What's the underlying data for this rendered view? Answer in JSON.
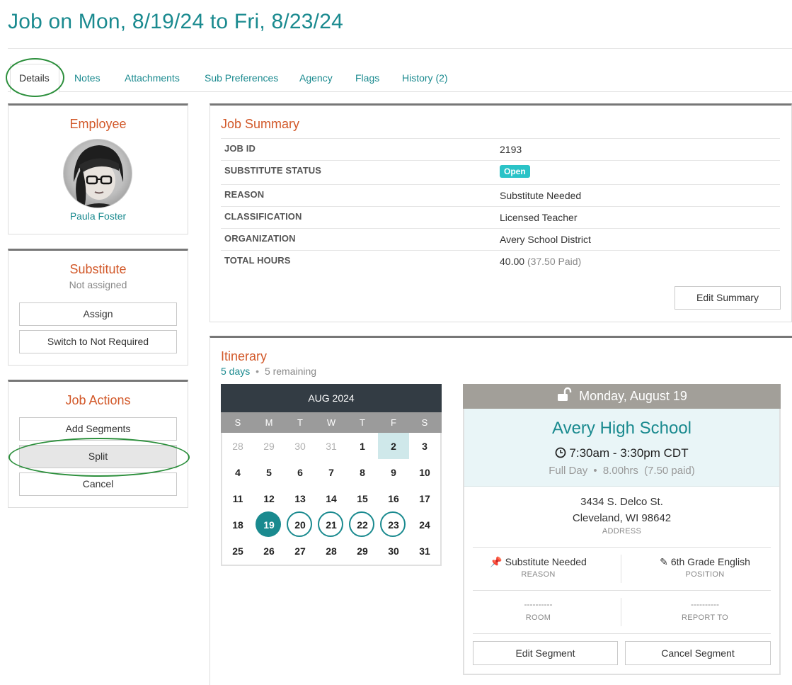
{
  "page": {
    "title": "Job on Mon, 8/19/24 to Fri, 8/23/24"
  },
  "tabs": [
    {
      "label": "Details"
    },
    {
      "label": "Notes"
    },
    {
      "label": "Attachments"
    },
    {
      "label": "Sub Preferences"
    },
    {
      "label": "Agency"
    },
    {
      "label": "Flags"
    },
    {
      "label": "History (2)"
    }
  ],
  "employee": {
    "title": "Employee",
    "name": "Paula Foster"
  },
  "substitute": {
    "title": "Substitute",
    "status": "Not assigned",
    "assign_label": "Assign",
    "not_required_label": "Switch to Not Required"
  },
  "job_actions": {
    "title": "Job Actions",
    "add_segments_label": "Add Segments",
    "split_label": "Split",
    "cancel_label": "Cancel"
  },
  "summary": {
    "title": "Job Summary",
    "rows": [
      {
        "label": "JOB ID",
        "value": "2193"
      },
      {
        "label": "SUBSTITUTE STATUS",
        "value": "Open"
      },
      {
        "label": "REASON",
        "value": "Substitute Needed"
      },
      {
        "label": "CLASSIFICATION",
        "value": "Licensed Teacher"
      },
      {
        "label": "ORGANIZATION",
        "value": "Avery School District"
      },
      {
        "label": "TOTAL HOURS",
        "value": "40.00",
        "extra": "(37.50 Paid)"
      }
    ],
    "edit_label": "Edit Summary"
  },
  "itinerary": {
    "title": "Itinerary",
    "days": "5 days",
    "separator": "•",
    "remaining": "5 remaining"
  },
  "calendar": {
    "month_label": "AUG 2024",
    "dow": [
      "S",
      "M",
      "T",
      "W",
      "T",
      "F",
      "S"
    ],
    "weeks": [
      [
        "28",
        "29",
        "30",
        "31",
        "1",
        "2",
        "3"
      ],
      [
        "4",
        "5",
        "6",
        "7",
        "8",
        "9",
        "10"
      ],
      [
        "11",
        "12",
        "13",
        "14",
        "15",
        "16",
        "17"
      ],
      [
        "18",
        "19",
        "20",
        "21",
        "22",
        "23",
        "24"
      ],
      [
        "25",
        "26",
        "27",
        "28",
        "29",
        "30",
        "31"
      ]
    ]
  },
  "segment": {
    "date": "Monday, August 19",
    "school": "Avery High School",
    "time": "7:30am - 3:30pm CDT",
    "day_type": "Full Day",
    "separator": "•",
    "hours": "8.00hrs",
    "paid": "(7.50 paid)",
    "address_line1": "3434 S. Delco St.",
    "address_line2": "Cleveland, WI 98642",
    "address_label": "ADDRESS",
    "reason_value": "Substitute Needed",
    "reason_label": "REASON",
    "position_value": "6th Grade English",
    "position_label": "POSITION",
    "room_value": "----------",
    "room_label": "ROOM",
    "report_value": "----------",
    "report_label": "REPORT TO",
    "edit_label": "Edit Segment",
    "cancel_label": "Cancel Segment"
  }
}
